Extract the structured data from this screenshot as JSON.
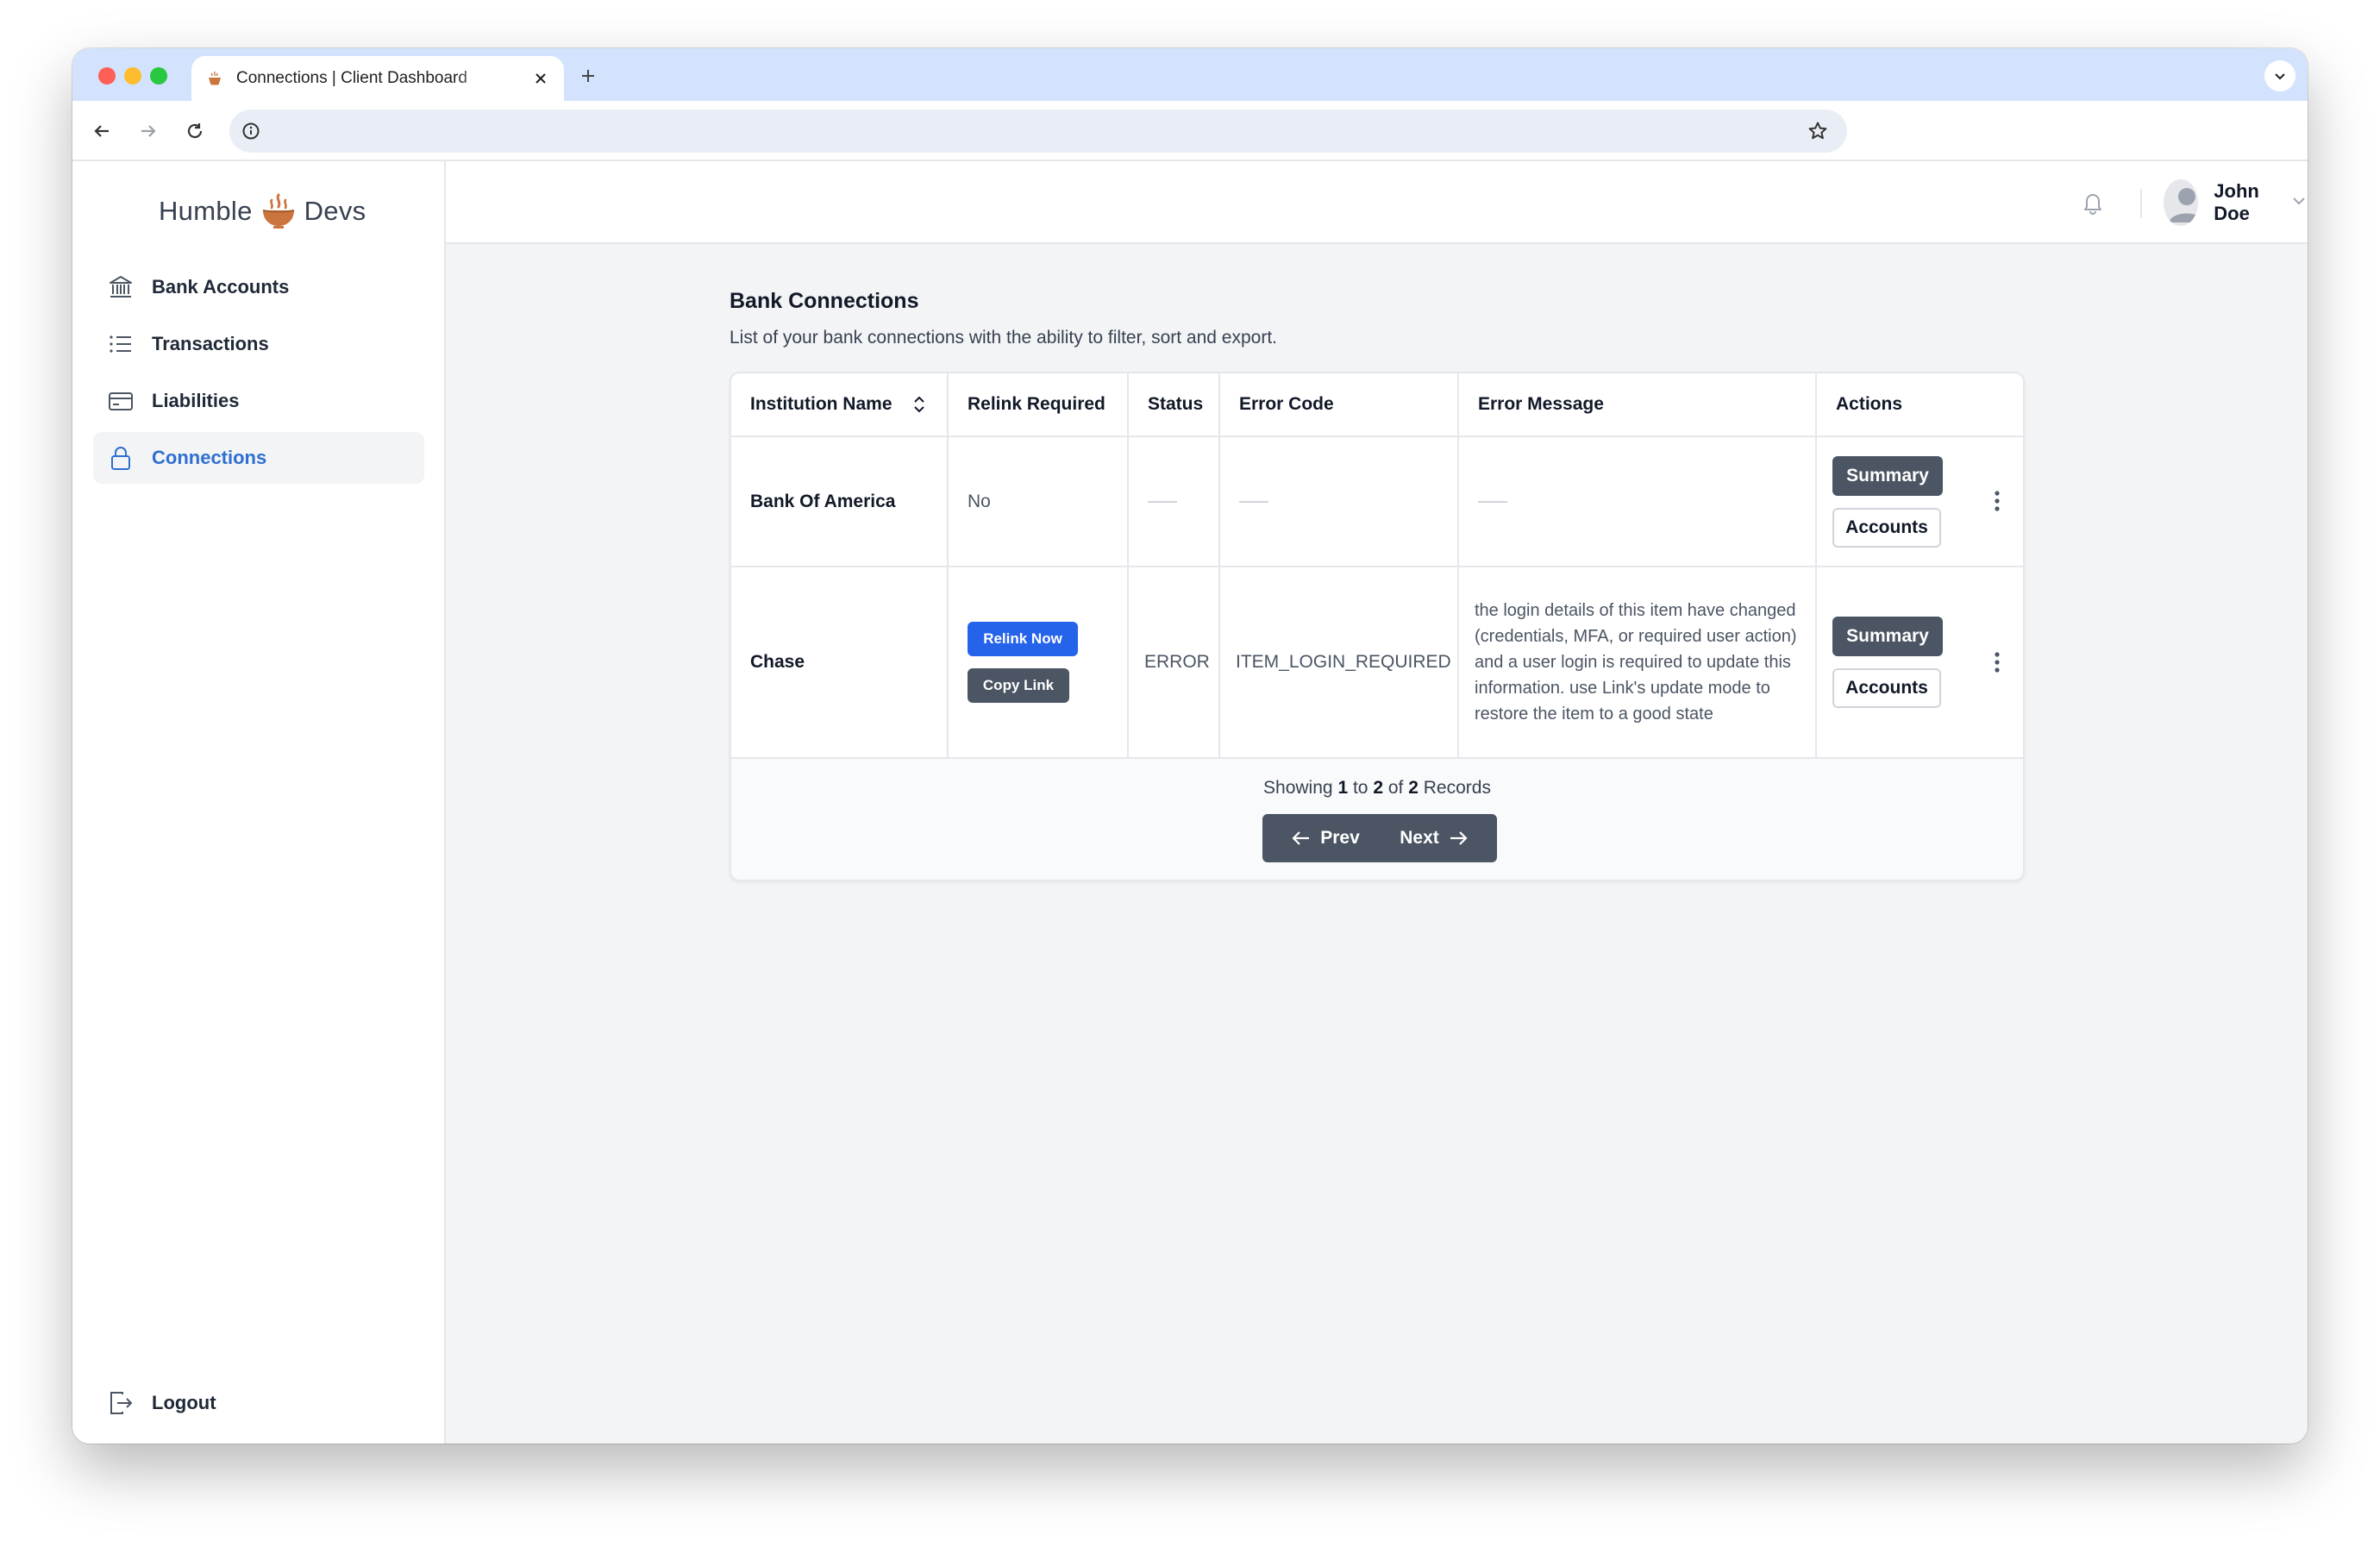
{
  "browser": {
    "tab_title": "Connections | Client Dashboard",
    "url": ""
  },
  "sidebar": {
    "logo": {
      "left": "Humble",
      "right": "Devs"
    },
    "items": [
      {
        "label": "Bank Accounts",
        "icon": "bank-icon"
      },
      {
        "label": "Transactions",
        "icon": "list-icon"
      },
      {
        "label": "Liabilities",
        "icon": "credit-card-icon"
      },
      {
        "label": "Connections",
        "icon": "lock-icon",
        "active": true
      }
    ],
    "logout_label": "Logout"
  },
  "header": {
    "user_name": "John Doe"
  },
  "page": {
    "title": "Bank Connections",
    "description": "List of your bank connections with the ability to filter, sort and export."
  },
  "table": {
    "columns": [
      "Institution Name",
      "Relink Required",
      "Status",
      "Error Code",
      "Error Message",
      "Actions"
    ],
    "rows": [
      {
        "institution": "Bank Of America",
        "relink": "No",
        "status": "",
        "error_code": "",
        "error_message": ""
      },
      {
        "institution": "Chase",
        "relink_now_label": "Relink Now",
        "copy_link_label": "Copy Link",
        "status": "ERROR",
        "error_code": "ITEM_LOGIN_REQUIRED",
        "error_message": "the login details of this item have changed (credentials, MFA, or required user action) and a user login is required to update this information. use Link's update mode to restore the item to a good state"
      }
    ],
    "actions": {
      "summary_label": "Summary",
      "accounts_label": "Accounts"
    }
  },
  "pagination": {
    "showing_label": "Showing",
    "from": "1",
    "to_label": "to",
    "to": "2",
    "of_label": "of",
    "total": "2",
    "records_label": "Records",
    "prev_label": "Prev",
    "next_label": "Next"
  },
  "colors": {
    "accent": "#2f6fd1",
    "primary_button": "#2563eb",
    "dark_button": "#4b5563",
    "logo_mark": "#c9753d"
  }
}
